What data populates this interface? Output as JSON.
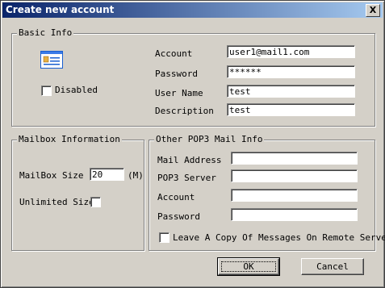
{
  "window": {
    "title": "Create new account",
    "close_glyph": "X"
  },
  "basic_info": {
    "legend": "Basic Info",
    "icon": "account-card-icon",
    "disabled_label": "Disabled",
    "disabled_checked": false,
    "account_label": "Account",
    "account_value": "user1@mail1.com",
    "password_label": "Password",
    "password_value": "******",
    "username_label": "User Name",
    "username_value": "test",
    "description_label": "Description",
    "description_value": "test"
  },
  "mailbox": {
    "legend": "Mailbox Information",
    "size_label": "MailBox Size",
    "size_value": "20",
    "size_unit": "(M)",
    "unlimited_label": "Unlimited Size",
    "unlimited_checked": false
  },
  "pop3": {
    "legend": "Other POP3 Mail Info",
    "mail_address_label": "Mail Address",
    "mail_address_value": "",
    "server_label": "POP3 Server",
    "server_value": "",
    "account_label": "Account",
    "account_value": "",
    "password_label": "Password",
    "password_value": "",
    "leave_copy_label": "Leave A Copy Of Messages On Remote Server",
    "leave_copy_checked": false
  },
  "buttons": {
    "ok": "OK",
    "cancel": "Cancel"
  },
  "colors": {
    "title_start": "#0a246a",
    "title_end": "#a6caf0",
    "face": "#d4d0c8"
  }
}
